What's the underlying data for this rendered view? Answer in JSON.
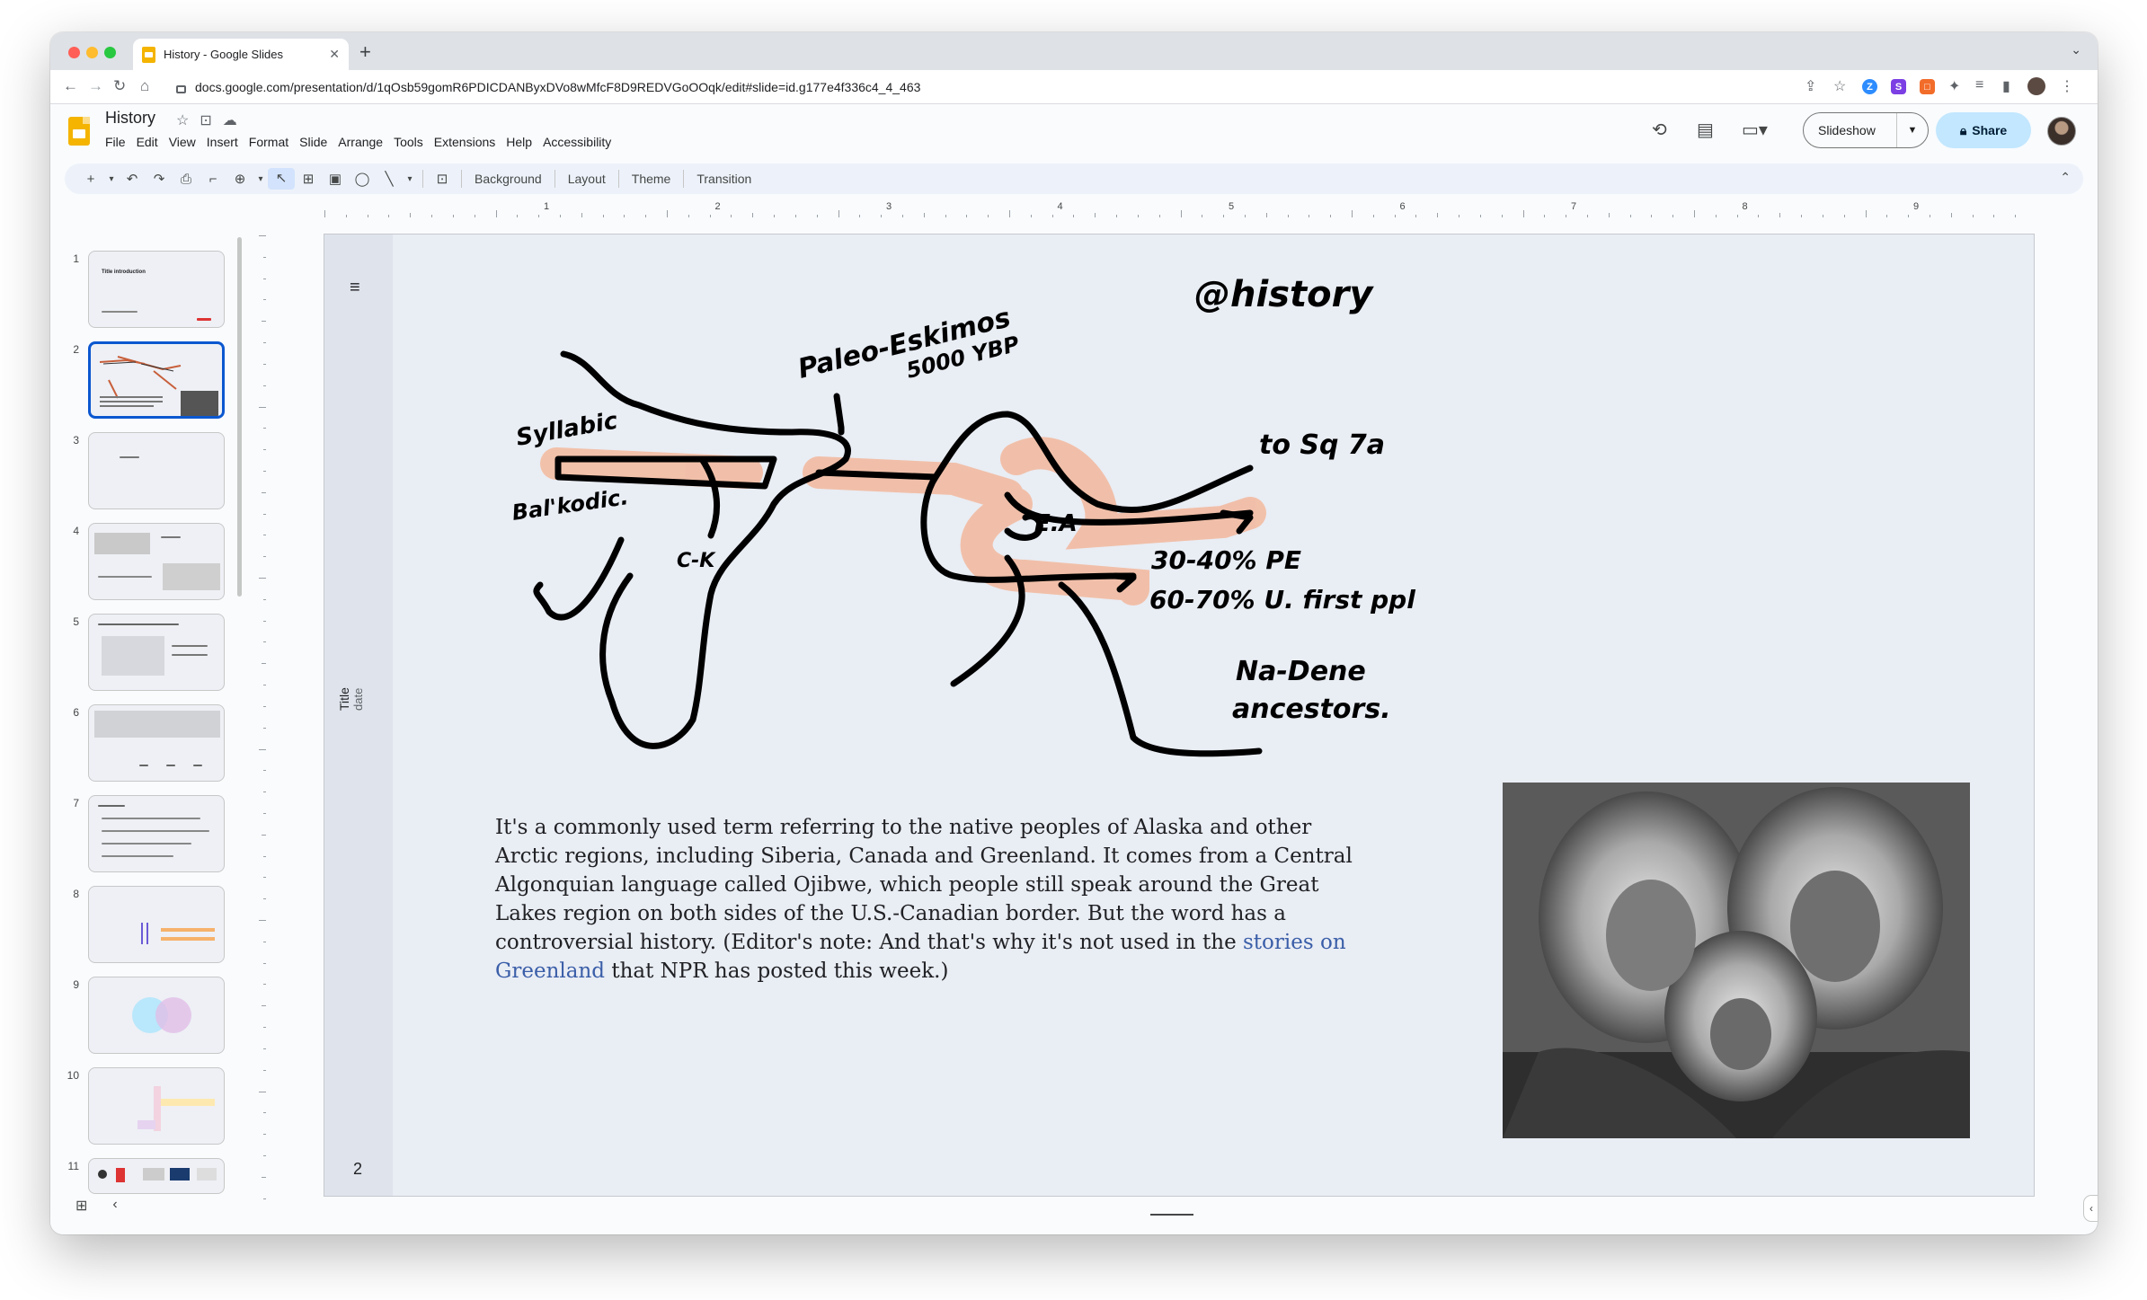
{
  "browser": {
    "tab_title": "History - Google Slides",
    "tab_close": "✕",
    "new_tab": "+",
    "url": "docs.google.com/presentation/d/1qOsb59gomR6PDICDANByxDVo8wMfcF8D9REDVGoOOqk/edit#slide=id.g177e4f336c4_4_463",
    "extensions": [
      {
        "name": "zoom-extension",
        "letter": "Z",
        "color": "#2d8cff"
      },
      {
        "name": "s-extension",
        "letter": "S",
        "color": "#7b3fe4"
      },
      {
        "name": "orange-extension",
        "letter": "□",
        "color": "#f26c2a"
      }
    ]
  },
  "header": {
    "doc_title": "History",
    "menus": [
      "File",
      "Edit",
      "View",
      "Insert",
      "Format",
      "Slide",
      "Arrange",
      "Tools",
      "Extensions",
      "Help",
      "Accessibility"
    ],
    "slideshow_label": "Slideshow",
    "share_label": "Share"
  },
  "toolbar": {
    "background": "Background",
    "layout": "Layout",
    "theme": "Theme",
    "transition": "Transition"
  },
  "filmstrip": {
    "slides": [
      {
        "num": "1",
        "label": "Title introduction"
      },
      {
        "num": "2",
        "label": ""
      },
      {
        "num": "3",
        "label": ""
      },
      {
        "num": "4",
        "label": ""
      },
      {
        "num": "5",
        "label": ""
      },
      {
        "num": "6",
        "label": ""
      },
      {
        "num": "7",
        "label": ""
      },
      {
        "num": "8",
        "label": ""
      },
      {
        "num": "9",
        "label": ""
      },
      {
        "num": "10",
        "label": ""
      },
      {
        "num": "11",
        "label": ""
      }
    ],
    "selected": "2"
  },
  "ruler": {
    "numbers": [
      "1",
      "2",
      "3",
      "4",
      "5",
      "6",
      "7",
      "8",
      "9"
    ]
  },
  "slide": {
    "side_title": "Title",
    "side_date": "date",
    "number": "2",
    "handwriting": {
      "at_history": "@history",
      "paleo": "Paleo-Eskimos",
      "years": "5000 YBP",
      "syllabic": "Syllabic",
      "bal_kodic": "Bal'kodic.",
      "ck": "C-K",
      "ea": "E.A",
      "to_sq": "to Sq 7a",
      "pe": "30-40% PE",
      "first_ppl": "60-70% U. first ppl",
      "na_dene": "Na-Dene",
      "ancestors": "ancestors."
    },
    "body_text_before": "It's a commonly used term referring to the native peoples of Alaska and other Arctic regions, including Siberia, Canada and Greenland. It comes from a Central Algonquian language called Ojibwe, which people still speak around the Great Lakes region on both sides of the U.S.-Canadian border. But the word has a controversial history. (Editor's note: And that's why it's not used in the ",
    "body_link": "stories on Greenland",
    "body_text_after": " that NPR has posted this week.)"
  },
  "colors": {
    "accent": "#0b57d0",
    "share_bg": "#c2e7ff",
    "highlight": "#f0a88c",
    "link": "#3a5ea8"
  }
}
